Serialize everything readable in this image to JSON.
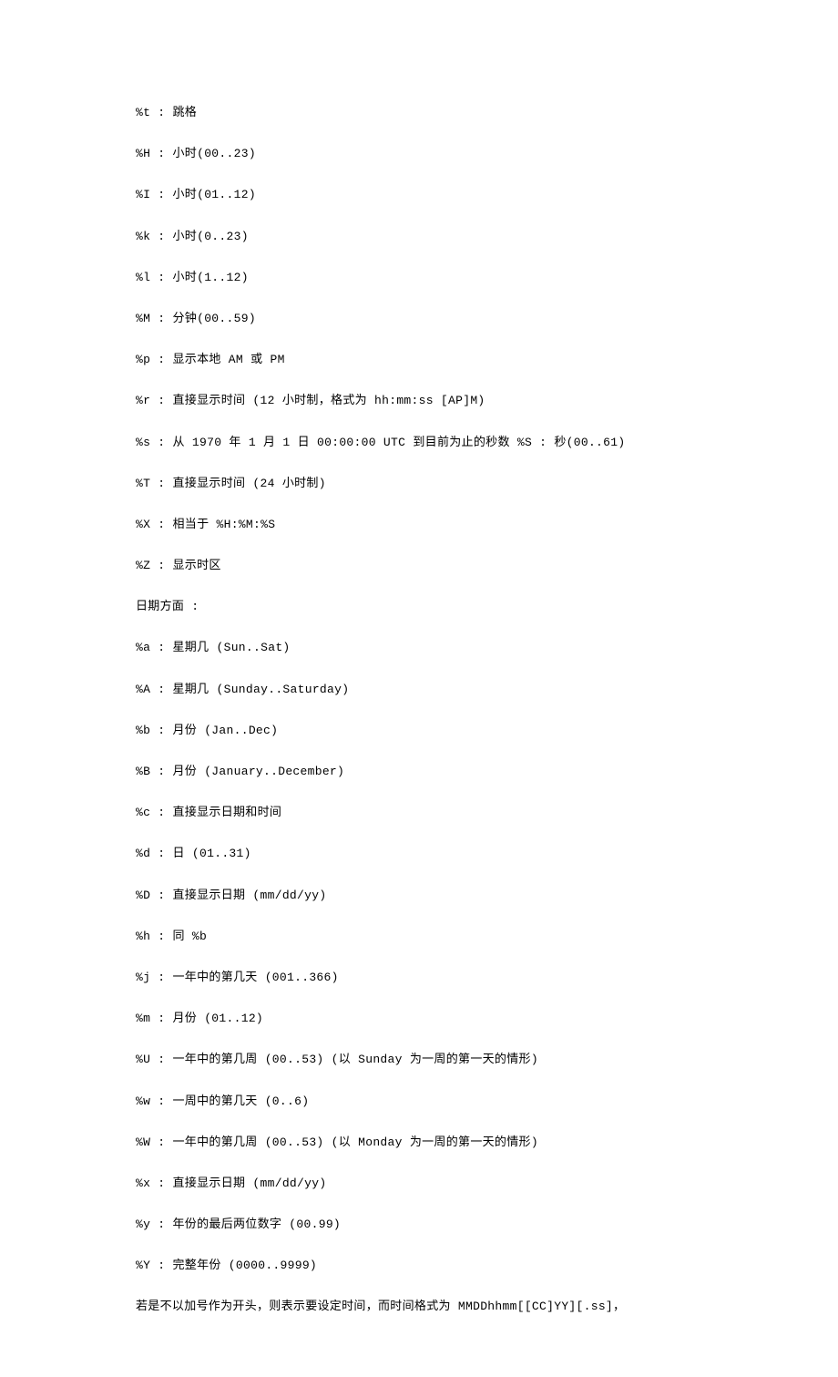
{
  "lines": [
    "%t : 跳格",
    "%H : 小时(00..23)",
    "%I : 小时(01..12)",
    "%k : 小时(0..23)",
    "%l : 小时(1..12)",
    "%M : 分钟(00..59)",
    "%p : 显示本地 AM 或 PM",
    "%r : 直接显示时间 (12 小时制，格式为 hh:mm:ss [AP]M)",
    "%s : 从 1970 年 1 月 1 日 00:00:00 UTC 到目前为止的秒数 %S : 秒(00..61)",
    "%T : 直接显示时间 (24 小时制)",
    "%X : 相当于 %H:%M:%S",
    "%Z : 显示时区",
    "日期方面 :",
    "%a : 星期几 (Sun..Sat)",
    "%A : 星期几 (Sunday..Saturday)",
    "%b : 月份 (Jan..Dec)",
    "%B : 月份 (January..December)",
    "%c : 直接显示日期和时间",
    "%d : 日 (01..31)",
    "%D : 直接显示日期 (mm/dd/yy)",
    "%h : 同 %b",
    "%j : 一年中的第几天 (001..366)",
    "%m : 月份 (01..12)",
    "%U : 一年中的第几周 (00..53) (以 Sunday 为一周的第一天的情形)",
    "%w : 一周中的第几天 (0..6)",
    "%W : 一年中的第几周 (00..53) (以 Monday 为一周的第一天的情形)",
    "%x : 直接显示日期 (mm/dd/yy)",
    "%y : 年份的最后两位数字 (00.99)",
    "%Y : 完整年份 (0000..9999)",
    "若是不以加号作为开头，则表示要设定时间，而时间格式为 MMDDhhmm[[CC]YY][.ss]，"
  ]
}
